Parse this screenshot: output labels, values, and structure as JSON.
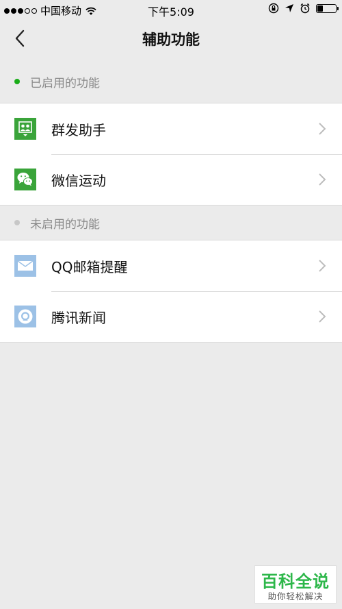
{
  "status_bar": {
    "carrier": "中国移动",
    "time": "下午5:09",
    "signal_bars_filled": 3,
    "signal_bars_total": 5,
    "battery_level": 0.33
  },
  "nav": {
    "title": "辅助功能",
    "back_icon": "chevron-left-icon"
  },
  "enabled_section": {
    "title": "已启用的功能",
    "dot_color": "#1aad19",
    "items": [
      {
        "label": "群发助手",
        "icon": "mass-message-icon",
        "icon_color": "#3aa43a"
      },
      {
        "label": "微信运动",
        "icon": "wechat-icon",
        "icon_color": "#3aa43a"
      }
    ]
  },
  "disabled_section": {
    "title": "未启用的功能",
    "dot_color": "#c7c7c7",
    "items": [
      {
        "label": "QQ邮箱提醒",
        "icon": "mail-icon",
        "icon_color": "#9cc1e6"
      },
      {
        "label": "腾讯新闻",
        "icon": "news-icon",
        "icon_color": "#9cc1e6"
      }
    ]
  },
  "watermark": {
    "title": "百科全说",
    "subtitle": "助你轻松解决"
  }
}
